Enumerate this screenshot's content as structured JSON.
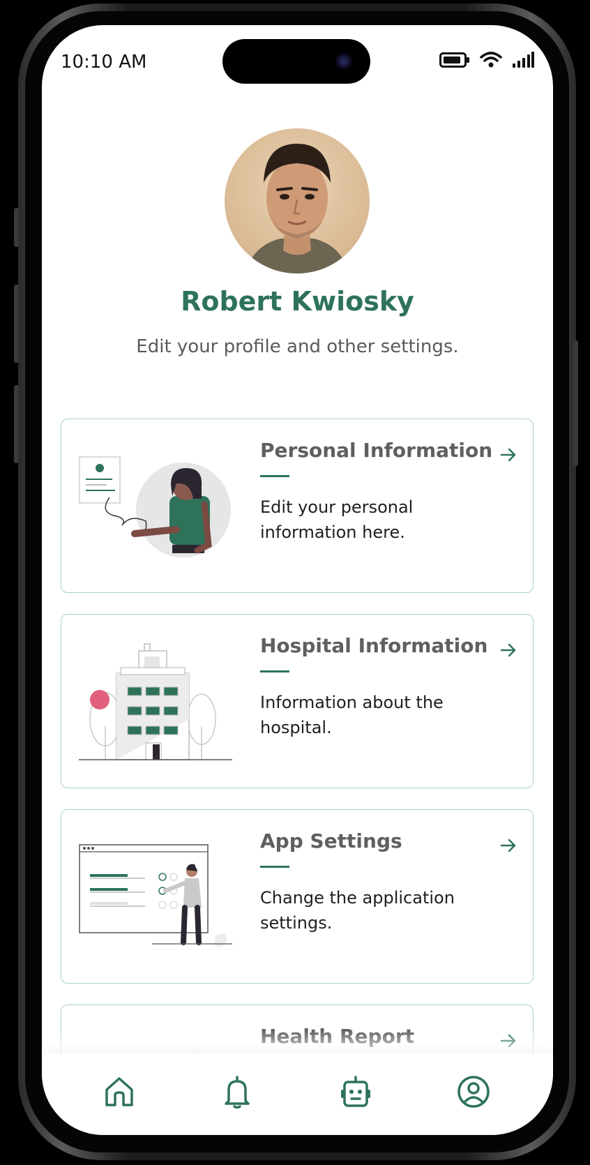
{
  "status_bar": {
    "time": "10:10 AM",
    "icons": [
      "battery-icon",
      "wifi-icon",
      "signal-icon"
    ]
  },
  "profile": {
    "name": "Robert Kwiosky",
    "subtitle": "Edit your profile and other settings."
  },
  "cards": [
    {
      "title": "Personal Information",
      "description": "Edit your personal information here.",
      "illustration": "person-with-form-illustration",
      "icon": "arrow-right-icon"
    },
    {
      "title": "Hospital Information",
      "description": "Information about the hospital.",
      "illustration": "hospital-building-illustration",
      "icon": "arrow-right-icon"
    },
    {
      "title": "App Settings",
      "description": "Change the application settings.",
      "illustration": "settings-checklist-illustration",
      "icon": "arrow-right-icon"
    },
    {
      "title": "Health Report",
      "description": "",
      "illustration": "health-report-illustration",
      "icon": "arrow-right-icon"
    }
  ],
  "bottom_nav": {
    "items": [
      {
        "icon": "home-icon",
        "active": false
      },
      {
        "icon": "bell-icon",
        "active": false
      },
      {
        "icon": "bot-icon",
        "active": false
      },
      {
        "icon": "profile-icon",
        "active": true
      }
    ]
  },
  "colors": {
    "accent": "#2e7359",
    "card_border": "#a8d2c0",
    "title_gray": "#5f5f5f",
    "text": "#1f1f1f"
  }
}
